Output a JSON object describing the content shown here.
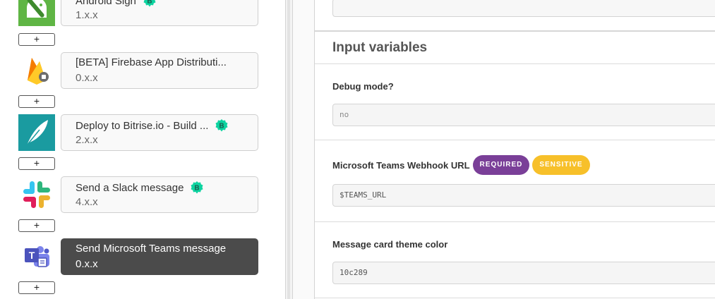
{
  "steps": [
    {
      "title": "Android Sign",
      "version": "1.x.x",
      "verified": true,
      "icon": "android-sign-icon"
    },
    {
      "title": "[BETA] Firebase App Distributi...",
      "version": "0.x.x",
      "verified": false,
      "icon": "firebase-icon"
    },
    {
      "title": "Deploy to Bitrise.io - Build ...",
      "version": "2.x.x",
      "verified": true,
      "icon": "bitrise-deploy-icon"
    },
    {
      "title": "Send a Slack message",
      "version": "4.x.x",
      "verified": true,
      "icon": "slack-icon"
    },
    {
      "title": "Send Microsoft Teams message",
      "version": "0.x.x",
      "verified": false,
      "icon": "microsoft-teams-icon",
      "selected": true
    }
  ],
  "add_label": "+",
  "panel": {
    "section_title": "Input variables",
    "fields": {
      "debug": {
        "label": "Debug mode?",
        "value": "no"
      },
      "webhook": {
        "label": "Microsoft Teams Webhook URL",
        "value": "$TEAMS_URL",
        "tag_required": "REQUIRED",
        "tag_sensitive": "SENSITIVE"
      },
      "theme": {
        "label": "Message card theme color",
        "value": "10c289"
      }
    }
  },
  "colors": {
    "verified_badge": "#0dd3a0",
    "required_tag": "#7a3f98",
    "sensitive_tag": "#f7c02a",
    "selected_step": "#4b4b4b"
  }
}
